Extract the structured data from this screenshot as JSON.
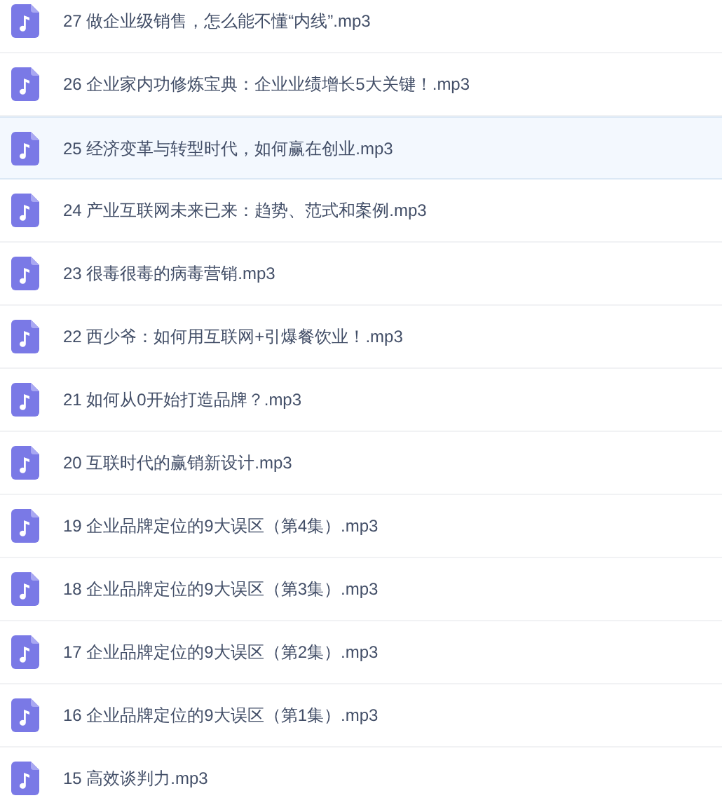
{
  "files": [
    {
      "name": "27 做企业级销售，怎么能不懂“内线”.mp3",
      "selected": false
    },
    {
      "name": "26 企业家内功修炼宝典：企业业绩增长5大关键！.mp3",
      "selected": false
    },
    {
      "name": "25 经济变革与转型时代，如何赢在创业.mp3",
      "selected": true
    },
    {
      "name": "24 产业互联网未来已来：趋势、范式和案例.mp3",
      "selected": false
    },
    {
      "name": "23 很毒很毒的病毒营销.mp3",
      "selected": false
    },
    {
      "name": "22 西少爷：如何用互联网+引爆餐饮业！.mp3",
      "selected": false
    },
    {
      "name": "21 如何从0开始打造品牌？.mp3",
      "selected": false
    },
    {
      "name": "20 互联时代的赢销新设计.mp3",
      "selected": false
    },
    {
      "name": "19 企业品牌定位的9大误区（第4集）.mp3",
      "selected": false
    },
    {
      "name": "18 企业品牌定位的9大误区（第3集）.mp3",
      "selected": false
    },
    {
      "name": "17 企业品牌定位的9大误区（第2集）.mp3",
      "selected": false
    },
    {
      "name": "16 企业品牌定位的9大误区（第1集）.mp3",
      "selected": false
    },
    {
      "name": "15 高效谈判力.mp3",
      "selected": false
    }
  ]
}
